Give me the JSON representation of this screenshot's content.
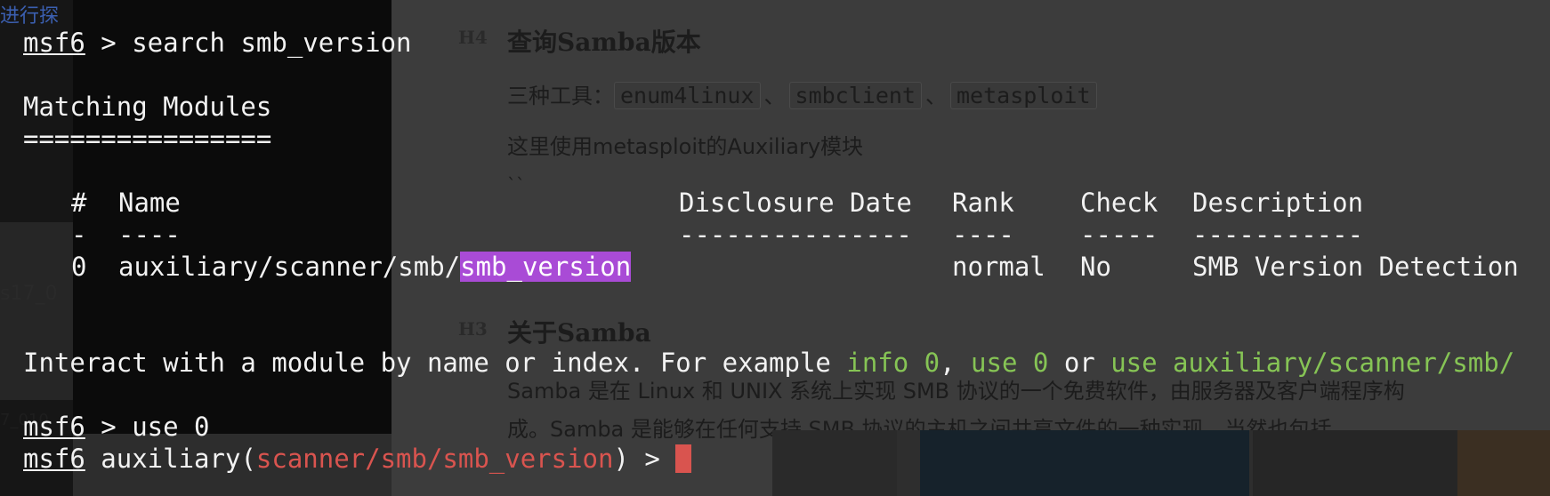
{
  "background_page": {
    "left_fragments": [
      "进行探",
      "s17_0",
      "7_010"
    ],
    "section1": {
      "tag": "H4",
      "heading": "查询Samba版本",
      "tools_prefix": "三种工具：",
      "tools": [
        "enum4linux",
        "smbclient",
        "metasploit"
      ],
      "tool_separator": "、",
      "note": "这里使用metasploit的Auxiliary模块",
      "backticks": "``"
    },
    "section2": {
      "tag": "H3",
      "heading": "关于Samba",
      "para_line1": "Samba 是在 Linux 和 UNIX 系统上实现 SMB 协议的一个免费软件，由服务器及客户端程序构",
      "para_line2": "成。Samba 是能够在任何支持 SMB 协议的主机之间共享文件的一种实现，当然也包括"
    }
  },
  "terminal": {
    "prompt": "msf6",
    "line1_cmd": " > search smb_version",
    "matching_title": "Matching Modules",
    "matching_rule": "================",
    "table": {
      "headers": {
        "num": "#",
        "name": "Name",
        "date": "Disclosure Date",
        "rank": "Rank",
        "check": "Check",
        "desc": "Description"
      },
      "rules": {
        "num": "-",
        "name": "----",
        "date": "---------------",
        "rank": "----",
        "check": "-----",
        "desc": "-----------"
      },
      "rows": [
        {
          "num": "0",
          "name_prefix": "auxiliary/scanner/smb/",
          "name_match": "smb_version",
          "date": "",
          "rank": "normal",
          "check": "No",
          "desc": "SMB Version Detection"
        }
      ]
    },
    "interact_text": "Interact with a module by name or index. For example ",
    "interact_ex1": "info 0",
    "interact_comma": ", ",
    "interact_ex2": "use 0",
    "interact_or": " or ",
    "interact_ex3": "use auxiliary/scanner/smb/",
    "line_use_cmd": " > use 0",
    "module_prompt_prefix": " auxiliary(",
    "module_path": "scanner/smb/smb_version",
    "module_prompt_suffix": ") > "
  },
  "colors": {
    "highlight": "#a94bd6",
    "green": "#86c455",
    "red": "#d9544f"
  }
}
